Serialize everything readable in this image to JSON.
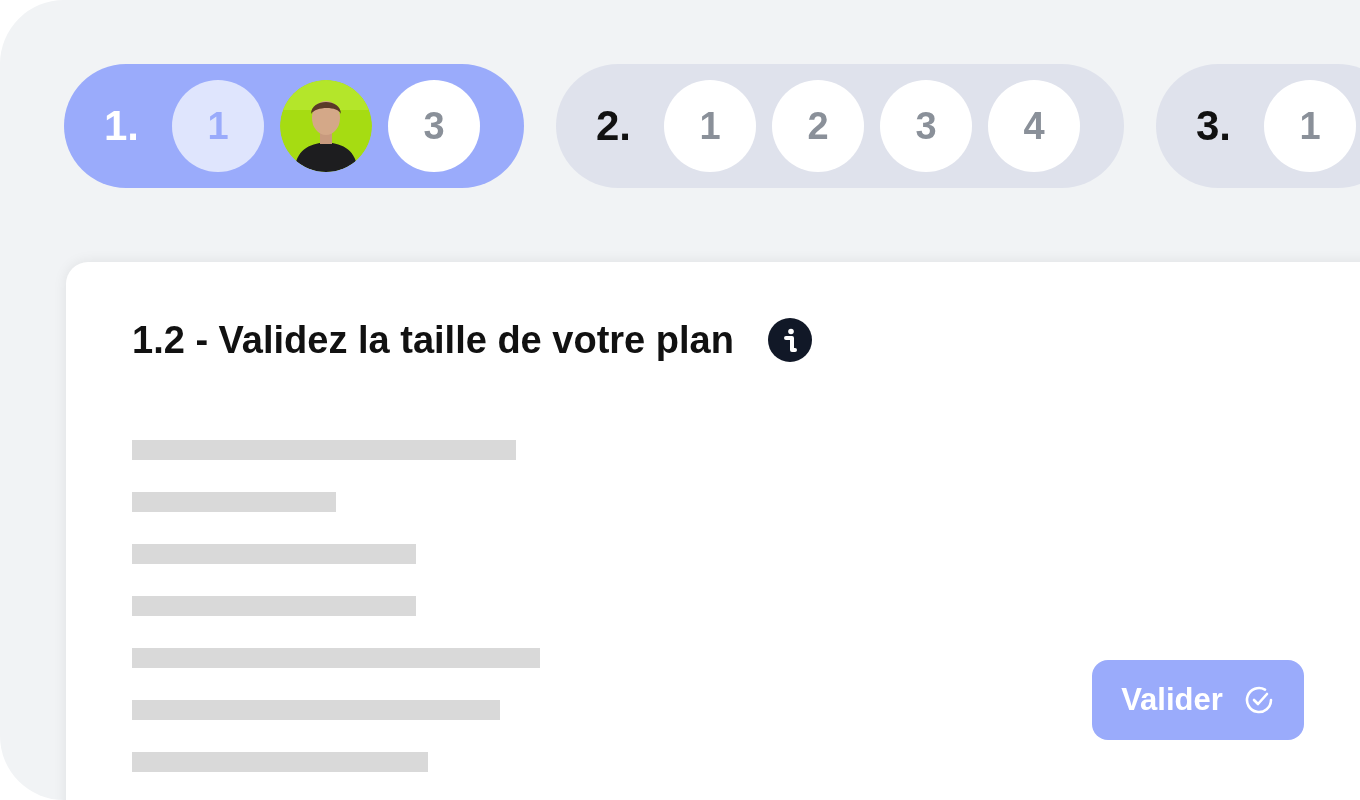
{
  "steps": [
    {
      "label": "1.",
      "selected": true,
      "items": [
        {
          "kind": "number",
          "label": "1",
          "done": true
        },
        {
          "kind": "picture"
        },
        {
          "kind": "number",
          "label": "3",
          "done": false
        }
      ]
    },
    {
      "label": "2.",
      "selected": false,
      "items": [
        {
          "kind": "number",
          "label": "1",
          "done": false
        },
        {
          "kind": "number",
          "label": "2",
          "done": false
        },
        {
          "kind": "number",
          "label": "3",
          "done": false
        },
        {
          "kind": "number",
          "label": "4",
          "done": false
        }
      ]
    },
    {
      "label": "3.",
      "selected": false,
      "items": [
        {
          "kind": "number",
          "label": "1",
          "done": false
        }
      ]
    }
  ],
  "card": {
    "title": "1.2 - Validez la taille de votre plan",
    "button": "Valider"
  }
}
